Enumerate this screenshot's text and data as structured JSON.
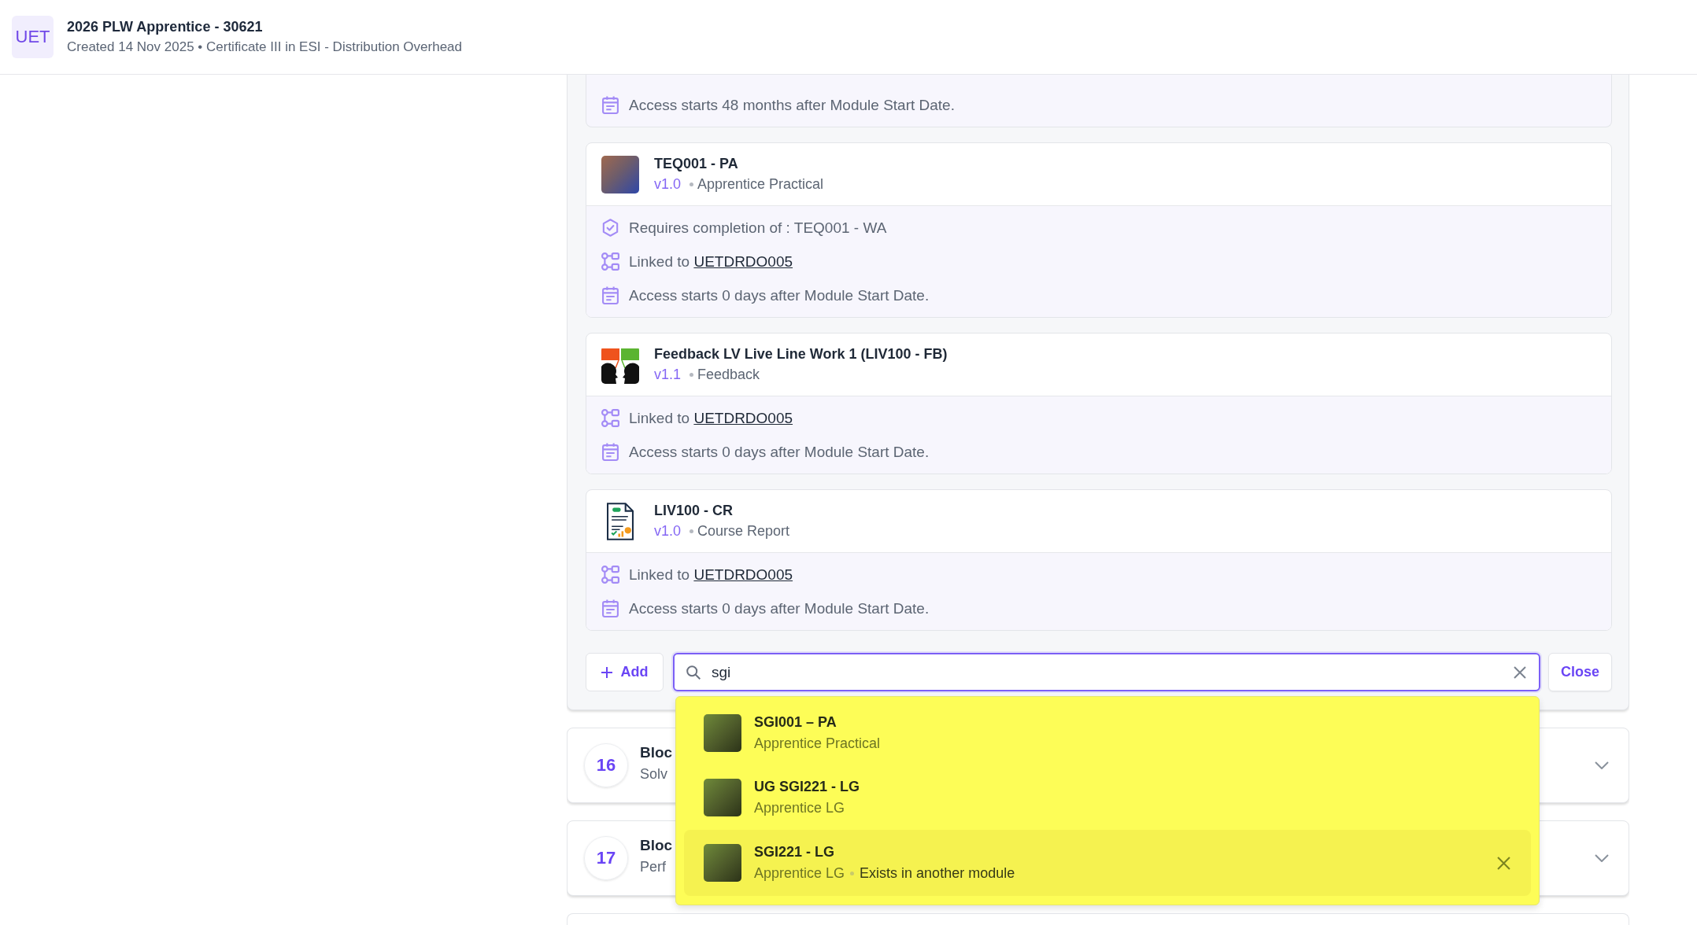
{
  "header": {
    "logo": "UET",
    "title": "2026 PLW Apprentice - 30621",
    "subtitle": "Created 14 Nov 2025 • Certificate III in ESI - Distribution Overhead"
  },
  "activities": [
    {
      "details": [
        {
          "kind": "access",
          "text": "Access starts 48 months after Module Start Date."
        }
      ]
    },
    {
      "thumbnail": {
        "kind": "photo"
      },
      "title": "TEQ001 - PA",
      "version": "v1.0",
      "type": "Apprentice Practical",
      "details": [
        {
          "kind": "requires",
          "text": "Requires completion of : TEQ001 - WA"
        },
        {
          "kind": "linked",
          "text": "Linked to",
          "link": "UETDRDO005"
        },
        {
          "kind": "access",
          "text": "Access starts 0 days after Module Start Date."
        }
      ]
    },
    {
      "thumbnail": {
        "kind": "feedback"
      },
      "title": "Feedback LV Live Line Work 1 (LIV100 - FB)",
      "version": "v1.1",
      "type": "Feedback",
      "details": [
        {
          "kind": "linked",
          "text": "Linked to",
          "link": "UETDRDO005"
        },
        {
          "kind": "access",
          "text": "Access starts 0 days after Module Start Date."
        }
      ]
    },
    {
      "thumbnail": {
        "kind": "report"
      },
      "title": "LIV100 - CR",
      "version": "v1.0",
      "type": "Course Report",
      "details": [
        {
          "kind": "linked",
          "text": "Linked to",
          "link": "UETDRDO005"
        },
        {
          "kind": "access",
          "text": "Access starts 0 days after Module Start Date."
        }
      ]
    }
  ],
  "add_button": "Add",
  "search": {
    "value": "sgi"
  },
  "close_button": "Close",
  "results": [
    {
      "thumbnail": {
        "kind": "photo"
      },
      "title": "SGI001 – PA",
      "type": "Apprentice Practical",
      "selected": false,
      "removable": false
    },
    {
      "thumbnail": {
        "kind": "photo"
      },
      "title": "UG SGI221 - LG",
      "type": "Apprentice LG",
      "selected": false,
      "removable": false
    },
    {
      "thumbnail": {
        "kind": "photo"
      },
      "title": "SGI221 - LG",
      "type": "Apprentice LG",
      "note": "Exists in another module",
      "selected": true,
      "removable": true
    }
  ],
  "blocks": [
    {
      "number": "16",
      "title": "Bloc",
      "subtitle": "Solv",
      "expanded": false
    },
    {
      "number": "17",
      "title": "Bloc",
      "subtitle": "Perf",
      "expanded": false
    }
  ]
}
